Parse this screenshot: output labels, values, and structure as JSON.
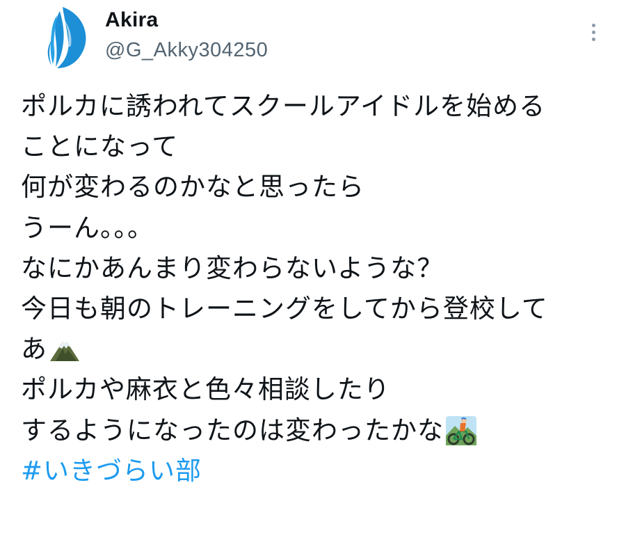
{
  "author": {
    "display_name": "Akira",
    "handle": "@G_Akky304250"
  },
  "tweet": {
    "lines": [
      "ポルカに誘われてスクールアイドルを始める",
      "ことになって",
      "何が変わるのかなと思ったら",
      "うーん。。。",
      "なにかあんまり変わらないような？",
      "今日も朝のトレーニングをしてから登校して",
      "あ",
      "ポルカや麻衣と色々相談したり",
      "するようになったのは変わったかな"
    ],
    "hashtag": "#いきづらい部"
  },
  "icons": {
    "avatar": "avatar-image",
    "more": "more-vertical-icon",
    "mountain_emoji": "snow-capped-mountain-emoji",
    "cyclist_emoji": "mountain-bicyclist-emoji"
  },
  "colors": {
    "text": "#0f1419",
    "secondary": "#536471",
    "link": "#1d9bf0",
    "avatar_blue": "#1c8fd6"
  }
}
